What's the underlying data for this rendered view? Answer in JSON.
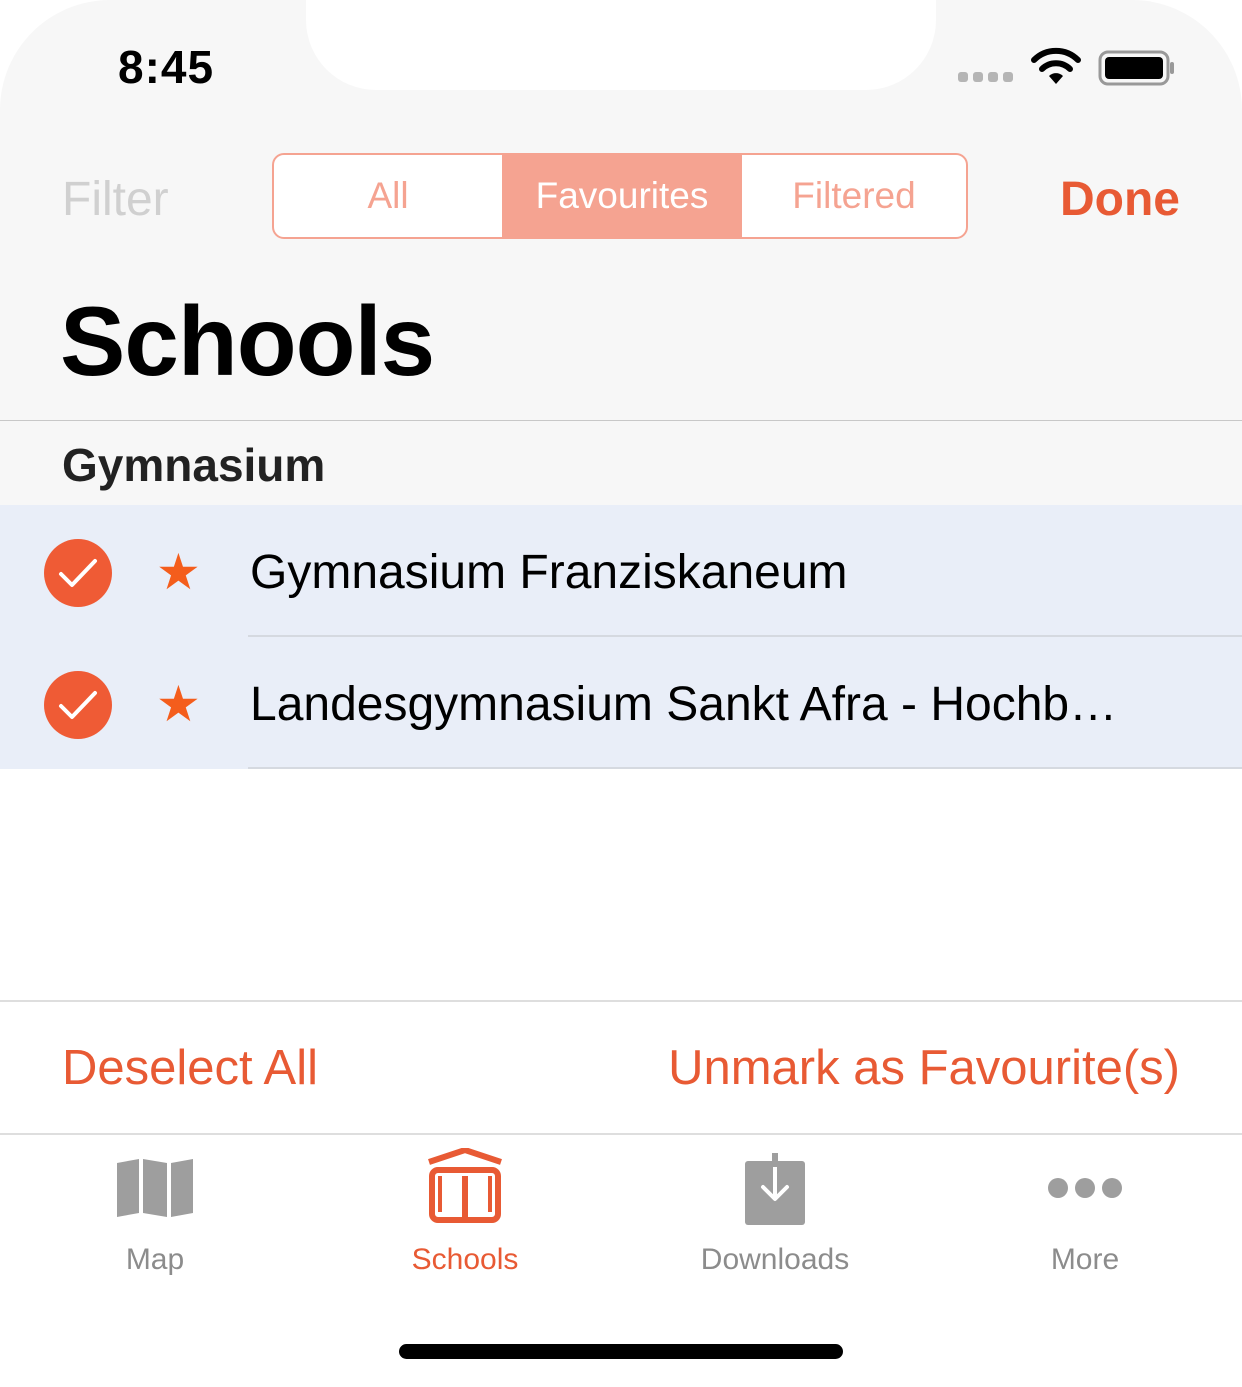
{
  "status_bar": {
    "time": "8:45"
  },
  "nav": {
    "filter_label": "Filter",
    "segments": [
      "All",
      "Favourites",
      "Filtered"
    ],
    "selected_segment": "Favourites",
    "done_label": "Done",
    "title": "Schools"
  },
  "section": {
    "title": "Gymnasium"
  },
  "rows": [
    {
      "name": "Gymnasium Franziskaneum",
      "selected": true,
      "favourite": true
    },
    {
      "name": "Landesgymnasium Sankt Afra - Hochb…",
      "selected": true,
      "favourite": true
    }
  ],
  "toolbar": {
    "deselect_all": "Deselect All",
    "unmark": "Unmark as Favourite(s)"
  },
  "tabs": [
    {
      "label": "Map",
      "icon": "map-icon"
    },
    {
      "label": "Schools",
      "icon": "book-icon",
      "active": true
    },
    {
      "label": "Downloads",
      "icon": "download-icon"
    },
    {
      "label": "More",
      "icon": "more-icon"
    }
  ],
  "colors": {
    "accent": "#e85a34",
    "segment_tint": "#f5a391",
    "selected_row_bg": "#e9eef8",
    "star": "#f45d1c"
  }
}
